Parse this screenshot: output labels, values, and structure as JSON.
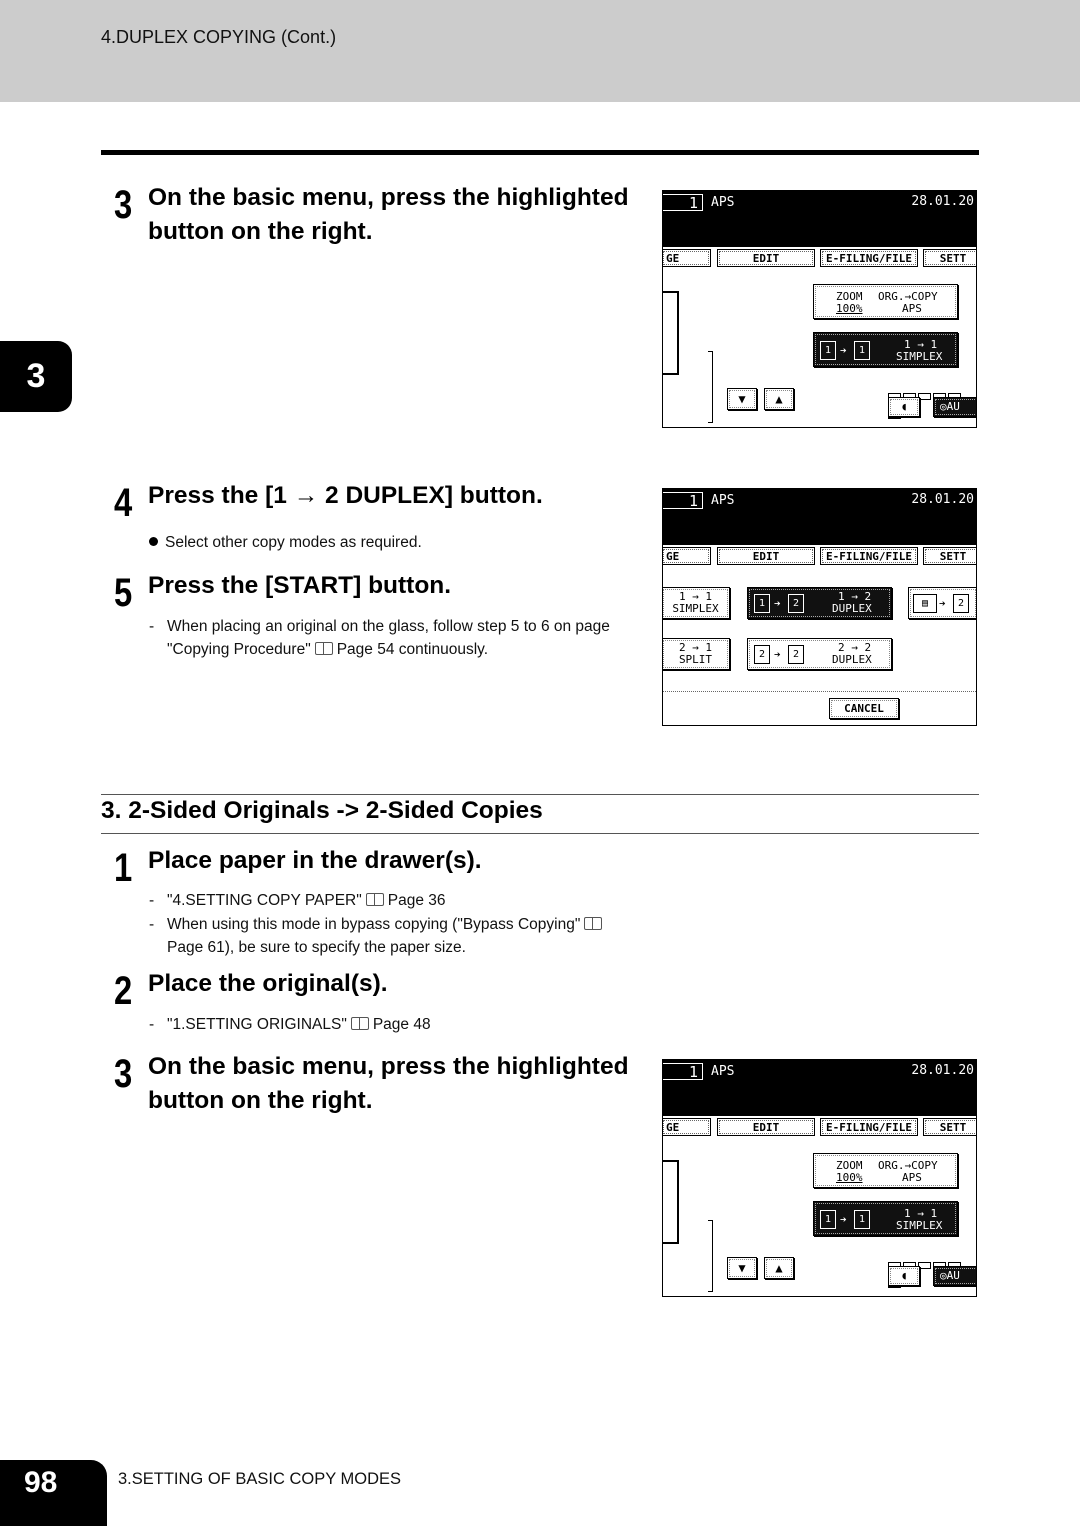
{
  "header": {
    "title": "4.DUPLEX COPYING (Cont.)"
  },
  "chapter_tab": "3",
  "steps_top": [
    {
      "num": "3",
      "title_line1": "On the basic menu, press the highlighted",
      "title_line2": "button on the right."
    },
    {
      "num": "4",
      "title": "Press the [1 → 2 DUPLEX] button.",
      "notes": [
        {
          "type": "bullet",
          "text": "Select other copy modes as required."
        }
      ]
    },
    {
      "num": "5",
      "title": "Press the [START] button.",
      "notes": [
        {
          "type": "dash",
          "text": "When placing an original on the glass, follow step 5 to 6 on page"
        },
        {
          "type": "cont",
          "text_before": "\"Copying Procedure\"",
          "text_after": "Page 54 continuously."
        }
      ]
    }
  ],
  "section": {
    "title": "3. 2-Sided Originals -> 2-Sided Copies"
  },
  "steps_bottom": [
    {
      "num": "1",
      "title": "Place paper in the drawer(s).",
      "notes": [
        {
          "text_before": "\"4.SETTING COPY PAPER\"",
          "text_after": "Page 36"
        },
        {
          "text_before": "When using this mode in bypass copying (\"Bypass Copying\"",
          "text_after": ""
        },
        {
          "text": "Page 61), be sure to specify the paper size."
        }
      ]
    },
    {
      "num": "2",
      "title": "Place the original(s).",
      "notes": [
        {
          "text_before": "\"1.SETTING ORIGINALS\"",
          "text_after": "Page 48"
        }
      ]
    },
    {
      "num": "3",
      "title_line1": "On the basic menu, press the highlighted",
      "title_line2": "button on the right."
    }
  ],
  "screens": {
    "basic": {
      "count": "1",
      "paper": "APS",
      "date": "28.01.20",
      "tabs": [
        "GE",
        "EDIT",
        "E-FILING/FILE",
        "SETT"
      ],
      "zoom_label": "ZOOM",
      "zoom_value": "100%",
      "org_copy_label": "ORG.→COPY",
      "org_copy_value": "APS",
      "duplex_line1": "1 → 1",
      "duplex_line2": "SIMPLEX",
      "auto_label": "AU"
    },
    "duplex_menu": {
      "count": "1",
      "paper": "APS",
      "date": "28.01.20",
      "tabs": [
        "GE",
        "EDIT",
        "E-FILING/FILE",
        "SETT"
      ],
      "simplex_1": "1 → 1",
      "simplex_2": "SIMPLEX",
      "duplex12_1": "1 → 2",
      "duplex12_2": "DUPLEX",
      "split_1": "2 → 1",
      "split_2": "SPLIT",
      "duplex22_1": "2 → 2",
      "duplex22_2": "DUPLEX",
      "cancel": "CANCEL"
    }
  },
  "footer": {
    "page_number": "98",
    "chapter_title": "3.SETTING OF BASIC COPY MODES"
  }
}
